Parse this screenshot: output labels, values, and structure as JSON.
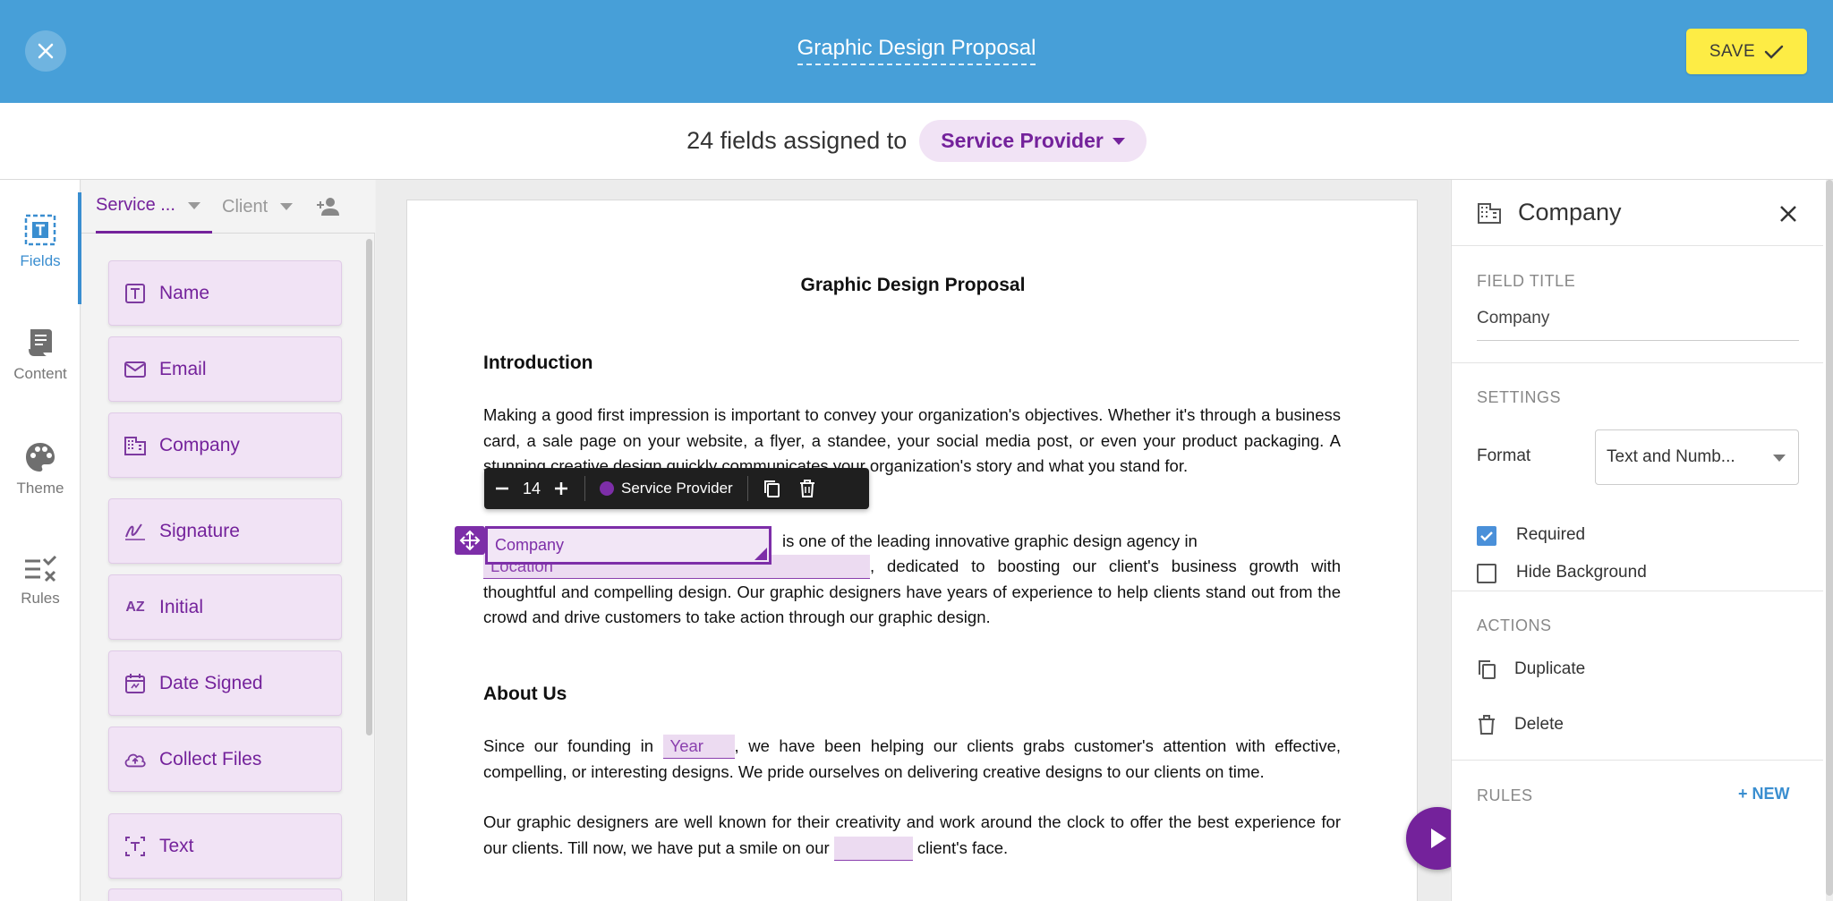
{
  "topbar": {
    "title": "Graphic Design Proposal",
    "save_label": "SAVE"
  },
  "assign": {
    "text": "24 fields assigned to",
    "role": "Service Provider"
  },
  "rail": {
    "items": [
      {
        "label": "Fields",
        "icon": "fields-icon",
        "active": true
      },
      {
        "label": "Content",
        "icon": "content-icon"
      },
      {
        "label": "Theme",
        "icon": "palette-icon"
      },
      {
        "label": "Rules",
        "icon": "rules-icon"
      }
    ]
  },
  "palette": {
    "tabs": [
      {
        "label": "Service ..."
      },
      {
        "label": "Client"
      }
    ],
    "fields": [
      {
        "label": "Name",
        "icon": "text-box-icon"
      },
      {
        "label": "Email",
        "icon": "envelope-icon"
      },
      {
        "label": "Company",
        "icon": "building-icon"
      },
      {
        "label": "Signature",
        "icon": "signature-icon"
      },
      {
        "label": "Initial",
        "icon": "initial-icon"
      },
      {
        "label": "Date Signed",
        "icon": "calendar-icon"
      },
      {
        "label": "Collect Files",
        "icon": "cloud-upload-icon"
      },
      {
        "label": "Text",
        "icon": "text-field-icon"
      }
    ]
  },
  "document": {
    "title": "Graphic Design Proposal",
    "intro_heading": "Introduction",
    "intro_p1": "Making a good first impression is important to convey your organization's objectives. Whether it's through a business card, a sale page on your website, a flyer, a standee, your social media post, or even your product packaging. A stunning creative design quickly communicates your organization's story and what you stand for.",
    "intro_p2_after_company": "is one of the leading innovative graphic design agency in",
    "intro_p2_rest": ", dedicated to boosting our client's business growth with thoughtful and compelling design. Our graphic designers have years of experience to help clients stand out from the crowd and drive customers to take action through our graphic design.",
    "location_field": "Location",
    "about_heading": "About Us",
    "about_p1_a": "Since our founding in",
    "year_field": "Year",
    "about_p1_b": ", we have been helping our clients grabs customer's attention with effective, compelling, or interesting designs. We pride ourselves on delivering creative designs to our clients on time.",
    "about_p2_a": "Our graphic designers are well known for their creativity and work around the clock to offer the best experience for our clients. Till now, we have put a smile on our",
    "about_p2_b": "client's face."
  },
  "field_toolbar": {
    "font_size": "14",
    "role": "Service Provider"
  },
  "selected_field": {
    "label": "Company"
  },
  "panel": {
    "title": "Company",
    "field_title_label": "FIELD TITLE",
    "field_title_value": "Company",
    "settings_label": "SETTINGS",
    "format_label": "Format",
    "format_value": "Text and Numb...",
    "required_label": "Required",
    "required_checked": true,
    "hide_bg_label": "Hide Background",
    "hide_bg_checked": false,
    "actions_label": "ACTIONS",
    "duplicate_label": "Duplicate",
    "delete_label": "Delete",
    "rules_label": "RULES",
    "new_label": "+ NEW"
  },
  "colors": {
    "topbar": "#479fd8",
    "accent_purple": "#74229b",
    "save_yellow": "#fdec45",
    "link_blue": "#3a8ed0"
  }
}
